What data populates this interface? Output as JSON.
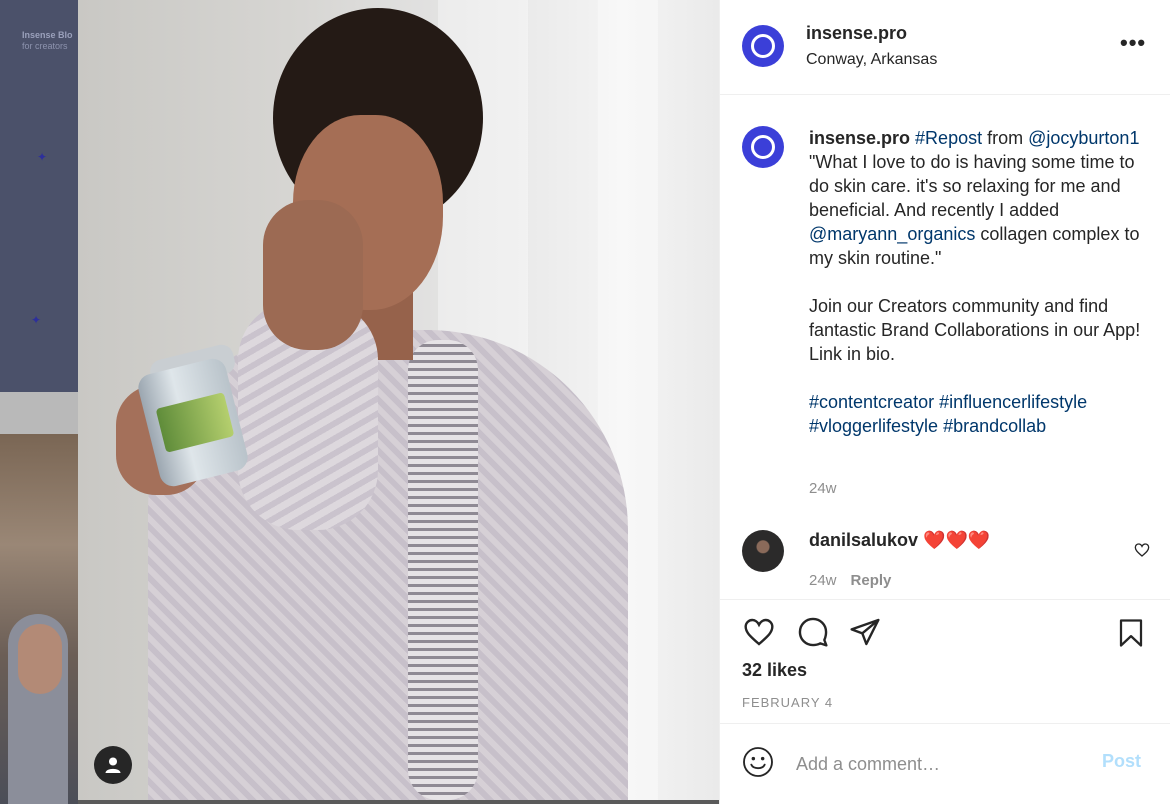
{
  "background_page": {
    "blog_title": "Insense Blo",
    "blog_subtitle": "for creators"
  },
  "post": {
    "username": "insense.pro",
    "location": "Conway, Arkansas",
    "more_icon": "more-horizontal-icon",
    "caption": {
      "username": "insense.pro",
      "hashtag_repost": "#Repost",
      "text_from": " from",
      "mention_author": "@jocyburton1",
      "text_quote": " \"What I love to do is having some time to do skin care. it's so relaxing for me and beneficial. And recently I added ",
      "mention_brand": "@maryann_organics",
      "text_quote_end": " collagen complex to my skin routine.\"",
      "paragraph_2": "Join our Creators community and find fantastic Brand Collaborations in our App! Link in bio.",
      "hashtags": [
        "#contentcreator",
        "#influencerlifestyle",
        "#vloggerlifestyle",
        "#brandcollab"
      ],
      "time": "24w"
    },
    "comments": [
      {
        "username": "danilsalukov",
        "text": " ❤️❤️❤️",
        "time": "24w",
        "reply_label": "Reply"
      }
    ],
    "likes": "32 likes",
    "date": "FEBRUARY 4",
    "add_comment": {
      "placeholder": "Add a comment…",
      "post_label": "Post"
    }
  },
  "colors": {
    "brand_avatar": "#3b3fd8",
    "link": "#00376b",
    "muted": "#8e8e8e",
    "post_disabled": "#b2dffc"
  }
}
